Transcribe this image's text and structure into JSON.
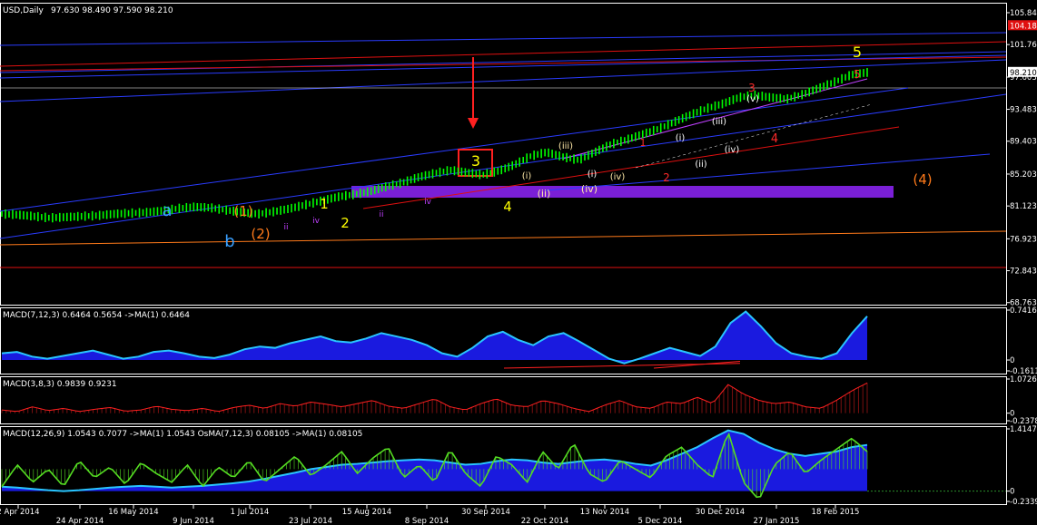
{
  "header": {
    "symbol_title": "USD,Daily",
    "ohlc": "97.630 98.490 97.590 98.210"
  },
  "colors": {
    "background": "#000000",
    "grid_border": "#ffffff",
    "candle": "#00ff00",
    "trend_blue": "#2a3cff",
    "trend_red": "#e01010",
    "orange": "#ff7a1a",
    "purple_zone": "#7a1fd6",
    "macd_fill": "#1a1adf",
    "macd_line": "#29c5ff",
    "signal_red": "#ff2020",
    "osma_green": "#55dd22",
    "wave_yellow": "#ffff00",
    "wave_blue": "#3aa0ff",
    "wave_magenta": "#c040ff",
    "wave_red": "#ff2a2a",
    "wave_cream": "#ffe9a8"
  },
  "chart_data": [
    {
      "type": "candlestick",
      "title": "USD,Daily",
      "ohlc_last": {
        "open": 97.63,
        "high": 98.49,
        "low": 97.59,
        "close": 98.21
      },
      "y_ticks": [
        105.843,
        101.763,
        97.603,
        93.483,
        89.403,
        85.203,
        81.123,
        76.923,
        72.843,
        68.763
      ],
      "ylim": [
        68.5,
        107.0
      ],
      "price_labels": [
        {
          "text": "104.183",
          "value": 104.183,
          "bg": "#e01010"
        },
        {
          "text": "98.210",
          "value": 98.21,
          "bg": "#ffffff"
        }
      ],
      "x_labels": [
        "2 Apr 2014",
        "24 Apr 2014",
        "16 May 2014",
        "9 Jun 2014",
        "1 Jul 2014",
        "23 Jul 2014",
        "15 Aug 2014",
        "8 Sep 2014",
        "30 Sep 2014",
        "22 Oct 2014",
        "13 Nov 2014",
        "5 Dec 2014",
        "30 Dec 2014",
        "27 Jan 2015",
        "18 Feb 2015"
      ],
      "series": [
        {
          "name": "close",
          "values": [
            80.1,
            80.0,
            79.8,
            79.6,
            79.7,
            79.8,
            79.9,
            80.1,
            80.2,
            80.3,
            80.5,
            80.8,
            81.0,
            80.9,
            80.6,
            80.3,
            80.1,
            80.4,
            80.8,
            81.3,
            81.8,
            82.3,
            82.6,
            83.0,
            83.6,
            84.1,
            84.8,
            85.3,
            85.7,
            85.4,
            85.1,
            85.6,
            86.4,
            87.5,
            88.0,
            87.4,
            87.0,
            88.0,
            89.0,
            89.6,
            90.3,
            91.0,
            91.9,
            92.8,
            93.6,
            94.2,
            95.0,
            95.3,
            95.0,
            94.8,
            95.4,
            96.2,
            97.0,
            97.9,
            98.2
          ]
        }
      ],
      "wave_labels": [
        {
          "text": "a",
          "color": "#3aa0ff"
        },
        {
          "text": "b",
          "color": "#3aa0ff"
        },
        {
          "text": "(1)",
          "color": "#ff7a1a"
        },
        {
          "text": "(2)",
          "color": "#ff7a1a"
        },
        {
          "text": "1",
          "color": "#ffff00"
        },
        {
          "text": "2",
          "color": "#ffff00"
        },
        {
          "text": "3",
          "color": "#ffff00"
        },
        {
          "text": "4",
          "color": "#ffff00"
        },
        {
          "text": "5",
          "color": "#ffff00"
        },
        {
          "text": "(4)",
          "color": "#ff7a1a"
        },
        {
          "text": "ii",
          "color": "#c040ff"
        },
        {
          "text": "iv",
          "color": "#c040ff"
        },
        {
          "text": "ii",
          "color": "#c040ff"
        },
        {
          "text": "iv",
          "color": "#c040ff"
        },
        {
          "text": "(ii)",
          "color": "#ffe9a8"
        },
        {
          "text": "(iii)",
          "color": "#ffe9a8"
        },
        {
          "text": "(iv)",
          "color": "#ffe9a8"
        },
        {
          "text": "(iv)",
          "color": "#ffe9a8"
        },
        {
          "text": "(i)",
          "color": "#ffe9a8"
        },
        {
          "text": "(i)",
          "color": "#ffffff"
        },
        {
          "text": "(iii)",
          "color": "#ffffff"
        },
        {
          "text": "(iv)",
          "color": "#ffffff"
        },
        {
          "text": "(v)",
          "color": "#ffffff"
        },
        {
          "text": "(ii)",
          "color": "#ffffff"
        },
        {
          "text": "(i)",
          "color": "#ffffff"
        },
        {
          "text": "1",
          "color": "#ff2a2a"
        },
        {
          "text": "2",
          "color": "#ff2a2a"
        },
        {
          "text": "3",
          "color": "#ff2a2a"
        },
        {
          "text": "4",
          "color": "#ff2a2a"
        },
        {
          "text": "5",
          "color": "#ff2a2a"
        }
      ]
    },
    {
      "type": "area",
      "title": "MACD(7,12,3) 0.6464 0.5654  ->MA(1) 0.6464",
      "y_ticks": [
        0.7416,
        0.0,
        -0.1611
      ],
      "ylim": [
        -0.1611,
        0.7416
      ],
      "series": [
        {
          "name": "MACD(7,12,3)",
          "values": [
            0.1,
            0.12,
            0.05,
            0.02,
            0.06,
            0.1,
            0.14,
            0.08,
            0.02,
            0.05,
            0.12,
            0.14,
            0.1,
            0.05,
            0.03,
            0.08,
            0.16,
            0.2,
            0.18,
            0.25,
            0.3,
            0.35,
            0.28,
            0.26,
            0.32,
            0.4,
            0.35,
            0.3,
            0.22,
            0.1,
            0.05,
            0.18,
            0.35,
            0.42,
            0.3,
            0.22,
            0.35,
            0.4,
            0.28,
            0.15,
            0.02,
            -0.05,
            0.02,
            0.1,
            0.18,
            0.12,
            0.06,
            0.2,
            0.55,
            0.72,
            0.5,
            0.25,
            0.1,
            0.05,
            0.02,
            0.1,
            0.4,
            0.65
          ]
        }
      ]
    },
    {
      "type": "line",
      "title": "MACD(3,8,3) 0.9839 0.9231",
      "y_ticks": [
        1.0726,
        0.0,
        -0.2378
      ],
      "ylim": [
        -0.2378,
        1.0726
      ],
      "series": [
        {
          "name": "MACD(3,8,3)",
          "values": [
            0.1,
            0.05,
            0.2,
            0.08,
            0.15,
            0.05,
            0.12,
            0.18,
            0.06,
            0.1,
            0.22,
            0.12,
            0.08,
            0.15,
            0.05,
            0.18,
            0.25,
            0.15,
            0.3,
            0.22,
            0.35,
            0.28,
            0.2,
            0.3,
            0.4,
            0.22,
            0.15,
            0.3,
            0.45,
            0.2,
            0.1,
            0.3,
            0.45,
            0.25,
            0.2,
            0.4,
            0.3,
            0.15,
            0.05,
            0.25,
            0.4,
            0.2,
            0.15,
            0.35,
            0.3,
            0.5,
            0.3,
            0.9,
            0.6,
            0.4,
            0.3,
            0.35,
            0.2,
            0.15,
            0.4,
            0.7,
            0.95
          ]
        }
      ]
    },
    {
      "type": "area",
      "title": "MACD(12,26,9) 1.0543 0.7077  ->MA(1) 1.0543  OsMA(7,12,3) 0.08105  ->MA(1) 0.08105",
      "y_ticks": [
        1.4147,
        0,
        -0.2339
      ],
      "ylim": [
        -0.2339,
        1.4147
      ],
      "series": [
        {
          "name": "MACD(12,26,9)",
          "values": [
            0.1,
            0.08,
            0.05,
            0.02,
            0.0,
            0.02,
            0.05,
            0.08,
            0.1,
            0.12,
            0.1,
            0.08,
            0.1,
            0.12,
            0.15,
            0.18,
            0.22,
            0.28,
            0.35,
            0.42,
            0.5,
            0.55,
            0.6,
            0.62,
            0.65,
            0.68,
            0.7,
            0.72,
            0.7,
            0.65,
            0.6,
            0.62,
            0.68,
            0.72,
            0.7,
            0.65,
            0.62,
            0.66,
            0.7,
            0.72,
            0.68,
            0.62,
            0.58,
            0.7,
            0.85,
            1.0,
            1.2,
            1.38,
            1.3,
            1.1,
            0.95,
            0.85,
            0.8,
            0.85,
            0.9,
            1.0,
            1.05
          ]
        },
        {
          "name": "OsMA(7,12,3)",
          "values": [
            0.1,
            0.6,
            0.2,
            0.5,
            0.1,
            0.7,
            0.3,
            0.55,
            0.15,
            0.65,
            0.4,
            0.2,
            0.6,
            0.1,
            0.55,
            0.3,
            0.7,
            0.2,
            0.5,
            0.8,
            0.35,
            0.6,
            0.9,
            0.4,
            0.75,
            1.0,
            0.3,
            0.6,
            0.2,
            0.95,
            0.4,
            0.1,
            0.8,
            0.6,
            0.2,
            0.9,
            0.5,
            1.1,
            0.4,
            0.2,
            0.7,
            0.5,
            0.3,
            0.8,
            1.0,
            0.6,
            0.3,
            1.35,
            0.2,
            -0.2,
            0.6,
            0.9,
            0.4,
            0.7,
            0.95,
            1.2,
            0.9
          ]
        }
      ]
    }
  ]
}
